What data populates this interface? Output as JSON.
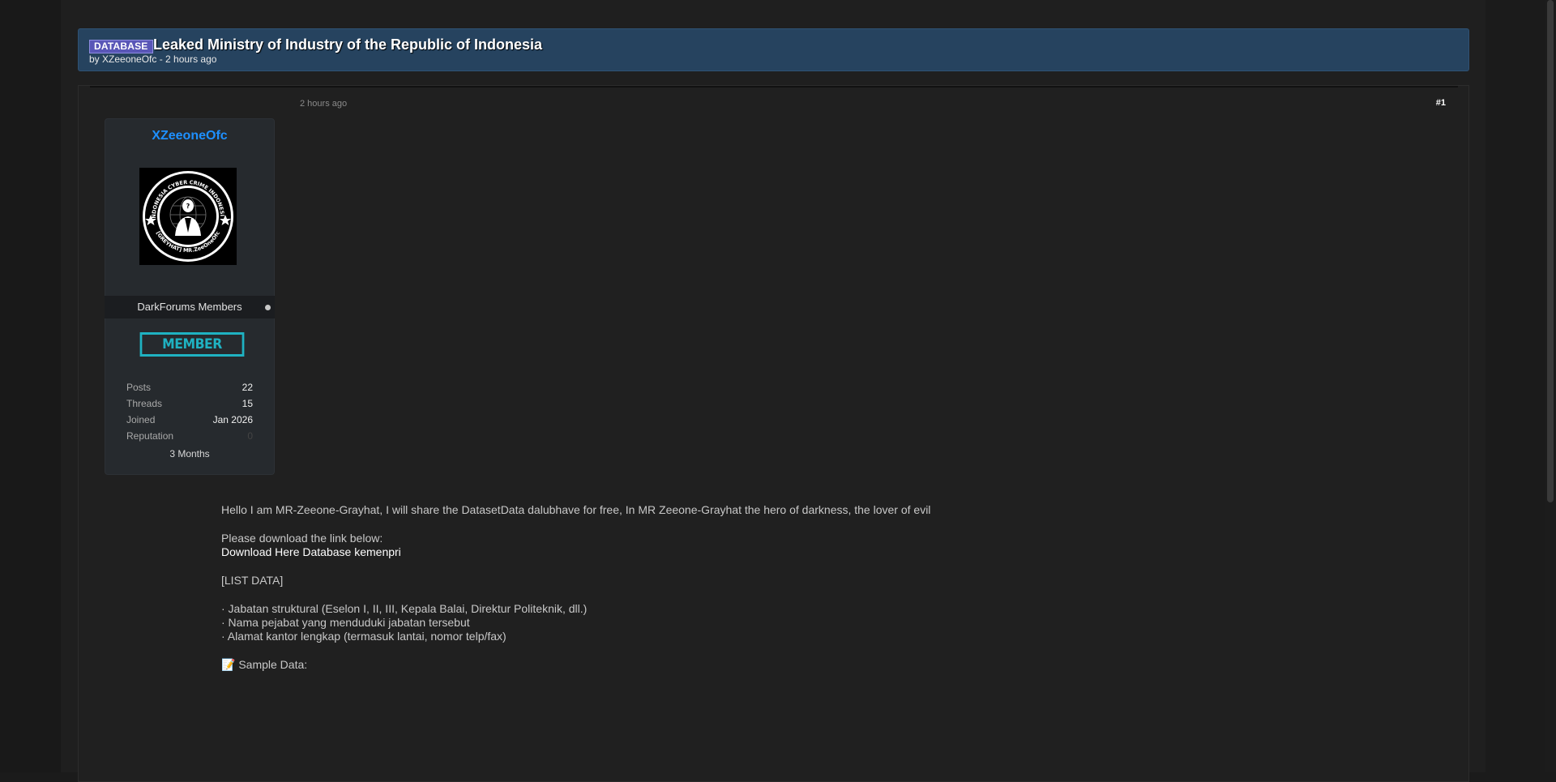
{
  "thread": {
    "prefix": "DATABASE",
    "title": "Leaked Ministry of Industry of the Republic of Indonesia",
    "meta": "by XZeeoneOfc - 2 hours ago"
  },
  "post": {
    "date": "2 hours ago",
    "number": "#1",
    "body": {
      "intro": "Hello I am MR-Zeeone-Grayhat, I will share the DatasetData dalubhave for free, In MR Zeeone-Grayhat the hero of darkness, the lover of evil",
      "download_prompt": "Please download the link below:",
      "download_link": "Download Here Database kemenpri",
      "list_header": "[LIST DATA]",
      "items": [
        "· Jabatan struktural (Eselon I, II, III, Kepala Balai, Direktur Politeknik, dll.)",
        "· Nama pejabat yang menduduki jabatan tersebut",
        "· Alamat kantor lengkap (termasuk lantai, nomor telp/fax)"
      ],
      "sample_icon": "📝",
      "sample_label": "Sample Data:"
    }
  },
  "author": {
    "username": "XZeeoneOfc",
    "avatar_text_top": "INDONESIA CYBER CRIME INDONESIA",
    "avatar_text_bottom": "[GREYHAT] MR.ZeeOneOfc",
    "group": "DarkForums Members",
    "badge": "MEMBER",
    "stats": [
      {
        "label": "Posts",
        "value": "22"
      },
      {
        "label": "Threads",
        "value": "15"
      },
      {
        "label": "Joined",
        "value": "Jan 2026"
      },
      {
        "label": "Reputation",
        "value": "0"
      }
    ],
    "membership_length": "3 Months"
  },
  "colors": {
    "header_bg": "#26435f",
    "prefix_bg": "#5956b7",
    "username": "#1e90ff",
    "badge": "#1fb2c2"
  }
}
